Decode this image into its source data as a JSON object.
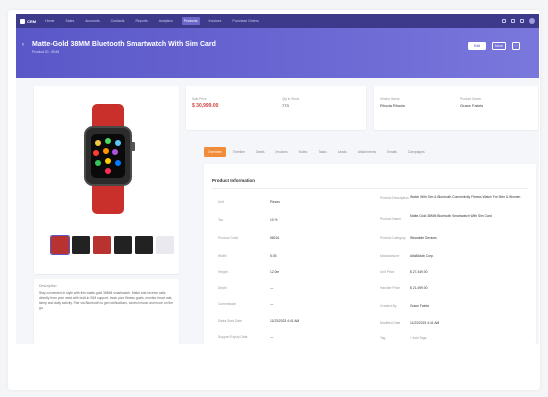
{
  "topnav": {
    "logo": "CRM",
    "items": [
      "Home",
      "Sales",
      "Accounts",
      "Contacts",
      "Reports",
      "Analytics",
      "Products",
      "Invoices",
      "Purchase Orders"
    ],
    "active_index": 6
  },
  "hero": {
    "title": "Matte-Gold 38MM Bluetooth Smartwatch With Sim Card",
    "subtitle": "Product ID : 8045",
    "buttons": {
      "edit": "Edit",
      "more": "More",
      "menu_icon": "ellipsis-icon"
    }
  },
  "stats": {
    "price_label": "Sale Price",
    "price_value": "$ 30,999.00",
    "stock_label": "Qty in Stock",
    "stock_value": "773",
    "vendor_label": "Vendor Name",
    "vendor_value": "Rhoda Rhoda",
    "handler_label": "Product Owner",
    "handler_value": "Grace Fabris"
  },
  "tabs": [
    "Overview",
    "Timeline",
    "Deals",
    "Invoices",
    "Notes",
    "Tasks",
    "Leads",
    "Attachments",
    "Emails",
    "Campaigns"
  ],
  "info": {
    "title": "Product Information",
    "left_rows": [
      {
        "label": "Unit",
        "value": "Pieces"
      },
      {
        "label": "Tax",
        "value": "10 %"
      },
      {
        "label": "Product Code",
        "value": "58216"
      },
      {
        "label": "Width",
        "value": "5.05"
      },
      {
        "label": "Height",
        "value": "12.0m"
      },
      {
        "label": "Depth",
        "value": "—"
      },
      {
        "label": "Commission",
        "value": "—"
      },
      {
        "label": "Sales Start Date",
        "value": "11/23/2023 4:41 AM"
      },
      {
        "label": "Support Expiry Date",
        "value": "—"
      }
    ],
    "right_rows": [
      {
        "label": "Product Description",
        "value": "Watch With Sim & Bluetooth Connectivity Fitness Watch For Men & Women"
      },
      {
        "label": "Product Name",
        "value": "Matte-Gold 38MM Bluetooth Smartwatch With Sim Card"
      },
      {
        "label": "Product Category",
        "value": "Wearable Devices"
      },
      {
        "label": "Manufacturer",
        "value": "AltaBiolab Corp."
      },
      {
        "label": "Unit Price",
        "value": "$ 27,449.00"
      },
      {
        "label": "Handler Price",
        "value": "$ 21,499.00"
      },
      {
        "label": "Created By",
        "value": "Grace Fabris"
      },
      {
        "label": "Modified Date",
        "value": "11/23/2023 4:41 AM"
      },
      {
        "label": "Tag",
        "value": "+ Add Tags"
      }
    ]
  },
  "description": {
    "title": "Description",
    "text": "Stay connected in style with this matte-gold 38MM smartwatch. Make and receive calls directly from your wrist with built-in SIM support, track your fitness goals, monitor heart rate, sleep and daily activity. Pair via Bluetooth to get notifications, control music and more on the go."
  },
  "colors": {
    "nav": "#3d3a8c",
    "hero": "#5a57c8",
    "accent_tab": "#f08c3a",
    "price": "#d23f3f",
    "strap": "#c9302c"
  }
}
